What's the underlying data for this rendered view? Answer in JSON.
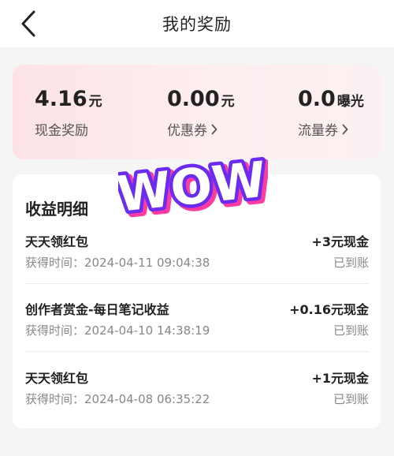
{
  "header": {
    "title": "我的奖励"
  },
  "rewards": [
    {
      "amount": "4.16",
      "unit": "元",
      "label": "现金奖励",
      "has_arrow": false
    },
    {
      "amount": "0.00",
      "unit": "元",
      "label": "优惠券",
      "has_arrow": true
    },
    {
      "amount": "0.0",
      "unit": "曝光",
      "label": "流量券",
      "has_arrow": true
    }
  ],
  "sticker": {
    "text": "WOW"
  },
  "details": {
    "title": "收益明细",
    "time_prefix": "获得时间：",
    "records": [
      {
        "title": "天天领红包",
        "time": "获得时间：2024-04-11 09:04:38",
        "amount": "+3元现金",
        "status": "已到账"
      },
      {
        "title": "创作者赏金-每日笔记收益",
        "time": "获得时间：2024-04-10 14:38:19",
        "amount": "+0.16元现金",
        "status": "已到账"
      },
      {
        "title": "天天领红包",
        "time": "获得时间：2024-04-08 06:35:22",
        "amount": "+1元现金",
        "status": "已到账"
      }
    ]
  },
  "colors": {
    "card_gradient_start": "#fde3e6",
    "sticker_fill": "#ffffff",
    "sticker_outline": "#6a2cf0",
    "sticker_shadow": "#ff3aa0"
  },
  "icons": {
    "back": "chevron-left-icon",
    "arrow": "chevron-right-icon"
  }
}
